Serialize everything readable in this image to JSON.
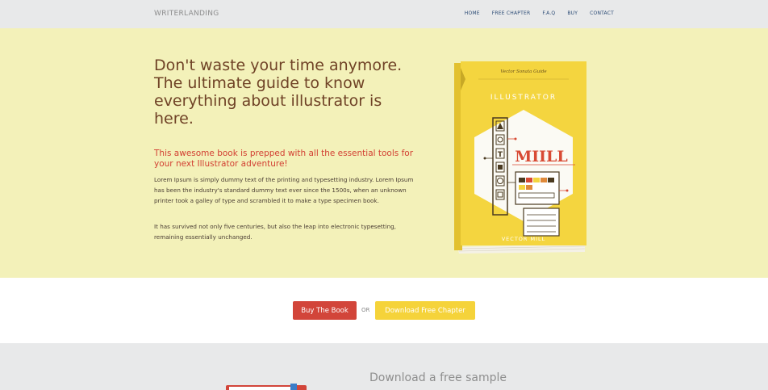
{
  "nav": {
    "brand": "WRITERLANDING",
    "links": [
      "HOME",
      "FREE CHAPTER",
      "F.A.Q",
      "BUY",
      "CONTACT"
    ]
  },
  "hero": {
    "headline": "Don't waste your time anymore. The ultimate guide to know everything about illustrator is here.",
    "subhead": "This awesome book is prepped with all the essential tools for your next Illustrator adventure!",
    "paragraph1": "Lorem Ipsum is simply dummy text of the printing and typesetting industry. Lorem Ipsum has been the industry's standard dummy text ever since the 1500s, when an unknown printer took a galley of type and scrambled it to make a type specimen book.",
    "paragraph2": "It has survived not only five centuries, but also the leap into electronic typesetting, remaining essentially unchanged."
  },
  "book": {
    "series": "Vector Sonata Guide",
    "title": "ILLUSTRATOR",
    "logo": "MIILL",
    "author": "VECTOR MILL"
  },
  "cta": {
    "buy_label": "Buy The Book",
    "or_label": "OR",
    "free_label": "Download Free Chapter"
  },
  "sample": {
    "title": "Download a free sample"
  },
  "colors": {
    "hero_bg": "#f3f1b9",
    "nav_bg": "#e8e9ea",
    "buy": "#d2453a",
    "free": "#f5d33a",
    "headline": "#6f4226",
    "book_yellow": "#f4d53f"
  }
}
